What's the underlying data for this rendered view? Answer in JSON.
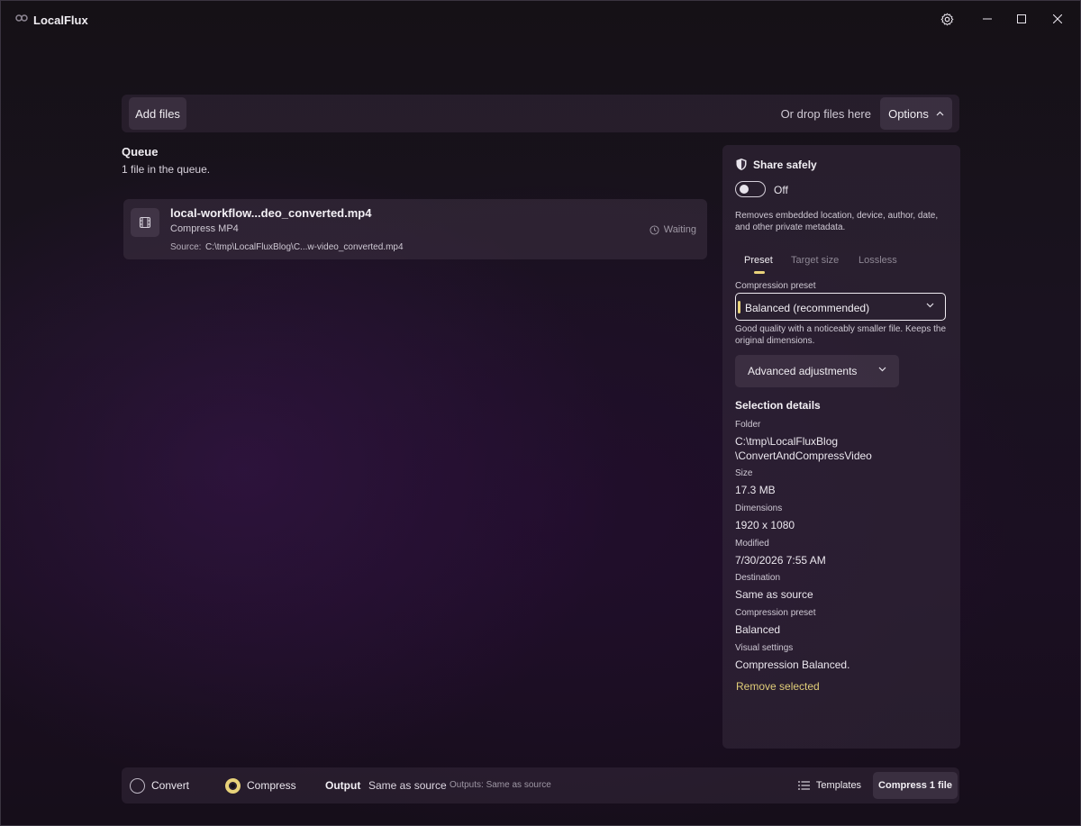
{
  "app": {
    "title": "LocalFlux"
  },
  "window_controls": {
    "settings": "gear-icon",
    "minimize": "minimize-icon",
    "maximize": "maximize-icon",
    "close": "close-icon"
  },
  "toolbar": {
    "add_files_label": "Add files",
    "drop_hint": "Or drop files here",
    "options_label": "Options"
  },
  "queue": {
    "title": "Queue",
    "count_text": "1 file in the queue.",
    "items": [
      {
        "name": "local-workflow...deo_converted.mp4",
        "operation": "Compress MP4",
        "source_label": "Source:",
        "source_path": "C:\\tmp\\LocalFluxBlog\\C...w-video_converted.mp4",
        "status": "Waiting",
        "icon": "film-icon"
      }
    ]
  },
  "panel": {
    "share": {
      "title": "Share safely",
      "toggle_state": "Off",
      "description": "Removes embedded location, device, author, date, and other private metadata."
    },
    "tabs": [
      "Preset",
      "Target size",
      "Lossless"
    ],
    "active_tab": "Preset",
    "preset": {
      "label": "Compression preset",
      "selected": "Balanced (recommended)",
      "help": "Good quality with a noticeably smaller file. Keeps the original dimensions.",
      "advanced_label": "Advanced adjustments"
    },
    "selection": {
      "title": "Selection details",
      "details": [
        {
          "label": "Folder",
          "value": "C:\\tmp\\LocalFluxBlog\n\\ConvertAndCompressVideo"
        },
        {
          "label": "Size",
          "value": "17.3 MB"
        },
        {
          "label": "Dimensions",
          "value": "1920 x 1080"
        },
        {
          "label": "Modified",
          "value": "7/30/2026 7:55 AM"
        },
        {
          "label": "Destination",
          "value": "Same as source"
        },
        {
          "label": "Compression preset",
          "value": "Balanced"
        },
        {
          "label": "Visual settings",
          "value": "Compression Balanced."
        }
      ],
      "remove_label": "Remove selected"
    }
  },
  "bottom": {
    "mode_convert": "Convert",
    "mode_compress": "Compress",
    "selected_mode": "Compress",
    "output_label": "Output",
    "output_value": "Same as source",
    "output_hint": "Outputs: Same as source",
    "templates_label": "Templates",
    "action_label": "Compress 1 file"
  },
  "colors": {
    "accent": "#e8d27a",
    "link": "#e0cd78",
    "background": "#1a1220"
  }
}
